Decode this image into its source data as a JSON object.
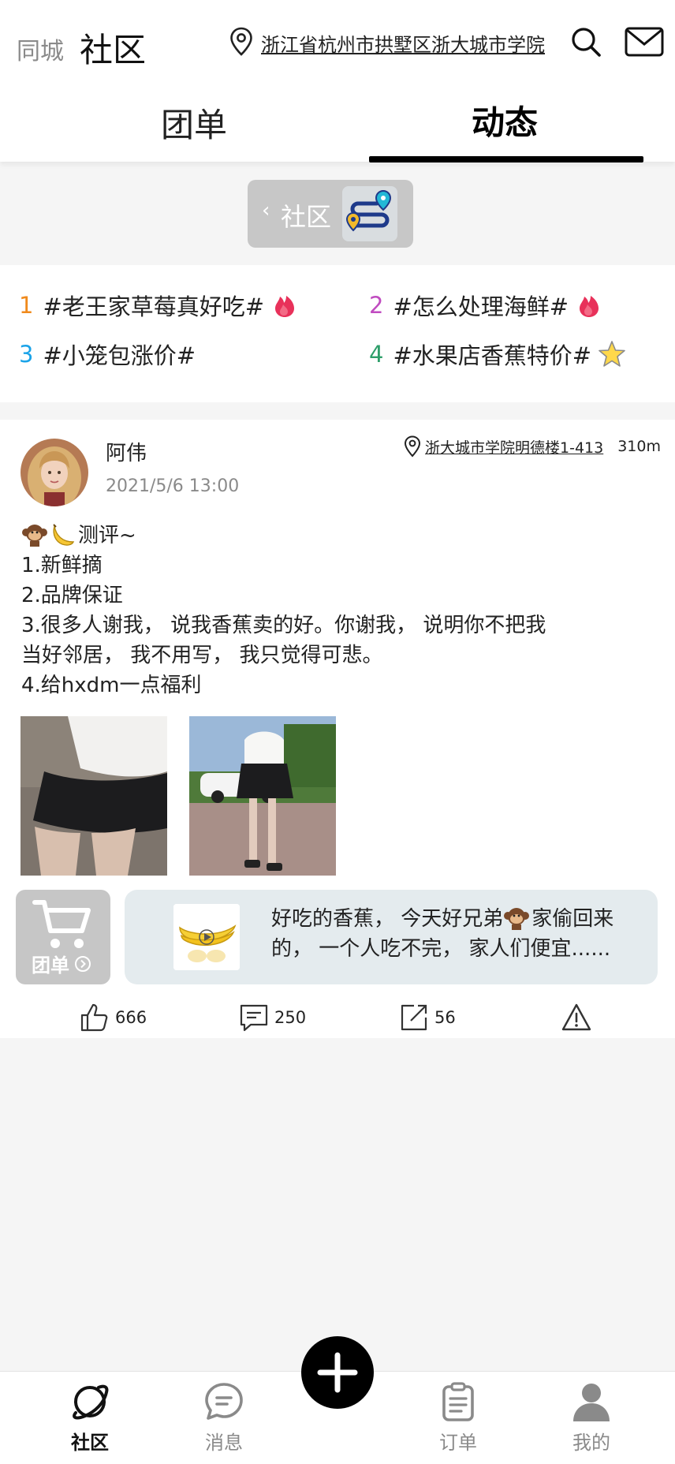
{
  "header": {
    "city_label": "同城",
    "title": "社区",
    "location": "浙江省杭州市拱墅区浙大城市学院",
    "icons": [
      "location-pin-icon",
      "search-icon",
      "mail-icon"
    ]
  },
  "tabs": [
    {
      "label": "团单",
      "active": false
    },
    {
      "label": "动态",
      "active": true
    }
  ],
  "community_chip": {
    "label": "社区",
    "icon": "map-route-icon"
  },
  "trending_topics": [
    {
      "rank": "1",
      "text": "#老王家草莓真好吃#",
      "badge": "hot-icon",
      "color": "#f08a1c"
    },
    {
      "rank": "2",
      "text": "#怎么处理海鲜#",
      "badge": "hot-icon",
      "color": "#c04bc0"
    },
    {
      "rank": "3",
      "text": "#小笼包涨价#",
      "badge": "",
      "color": "#1aa3e8"
    },
    {
      "rank": "4",
      "text": "#水果店香蕉特价#",
      "badge": "star-icon",
      "color": "#2e9e6a"
    }
  ],
  "post": {
    "author": "阿伟",
    "time": "2021/5/6  13:00",
    "location": "浙大城市学院明德楼1-413",
    "distance": "310m",
    "content_lines": [
      "测评~",
      "1.新鲜摘",
      "2.品牌保证",
      "3.很多人谢我，  说我香蕉卖的好。你谢我，  说明你不把我",
      "当好邻居，  我不用写，  我只觉得可悲。",
      "4.给hxdm一点福利"
    ],
    "group_buy": {
      "label": "团单"
    },
    "product": {
      "text_before": "好吃的香蕉，  今天好兄弟",
      "text_after": "家偷回来的，  一个人吃不完，  家人们便宜......"
    },
    "actions": {
      "likes": "666",
      "comments": "250",
      "shares": "56"
    }
  },
  "bottom_nav": [
    {
      "label": "社区",
      "icon": "planet-icon",
      "active": true
    },
    {
      "label": "消息",
      "icon": "message-icon",
      "active": false
    },
    {
      "label": "订单",
      "icon": "clipboard-icon",
      "active": false
    },
    {
      "label": "我的",
      "icon": "person-icon",
      "active": false
    }
  ],
  "colors": {
    "accent": "#000000",
    "hot": "#e8315a",
    "muted": "#8a8a8a",
    "chip_bg": "#c7c7c7",
    "product_bg": "#e4ebee"
  }
}
